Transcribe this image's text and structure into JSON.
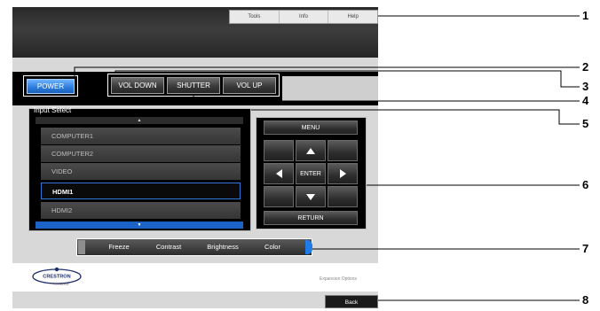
{
  "top_menu": [
    "Tools",
    "Info",
    "Help"
  ],
  "buttons": {
    "power": "POWER",
    "vol_down": "VOL DOWN",
    "shutter": "SHUTTER",
    "vol_up": "VOL UP"
  },
  "input_select": {
    "title": "Input Select",
    "items": [
      {
        "label": "COMPUTER1",
        "selected": false
      },
      {
        "label": "COMPUTER2",
        "selected": false
      },
      {
        "label": "VIDEO",
        "selected": false
      },
      {
        "label": "HDMI1",
        "selected": true
      },
      {
        "label": "HDMI2",
        "selected": false
      }
    ]
  },
  "control_pad": {
    "menu": "MENU",
    "enter": "ENTER",
    "return": "RETURN"
  },
  "tab_bar": [
    "Freeze",
    "Contrast",
    "Brightness",
    "Color"
  ],
  "footer": {
    "logo_text": "CRESTRON",
    "logo_sub": "connected",
    "expansion": "Expansion Options",
    "back": "Back"
  },
  "callouts": [
    "1",
    "2",
    "3",
    "4",
    "5",
    "6",
    "7",
    "8"
  ],
  "colors": {
    "accent_blue": "#2f7fe0",
    "panel_bg": "#d8d8d8",
    "button_dark": "#2e2e2e"
  }
}
